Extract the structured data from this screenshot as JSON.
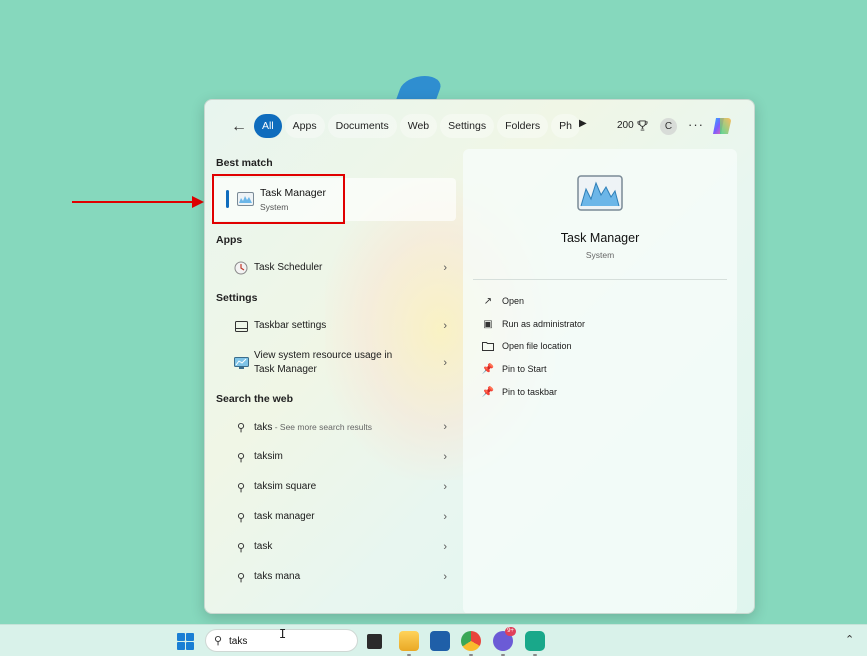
{
  "filters": {
    "items": [
      "All",
      "Apps",
      "Documents",
      "Web",
      "Settings",
      "Folders",
      "Ph"
    ],
    "active_index": 0,
    "points": "200"
  },
  "avatar_initial": "C",
  "sections": {
    "best_match": "Best match",
    "apps": "Apps",
    "settings": "Settings",
    "search_web": "Search the web"
  },
  "best_match": {
    "title": "Task Manager",
    "subtitle": "System"
  },
  "apps": [
    {
      "label": "Task Scheduler"
    }
  ],
  "settings": [
    {
      "label": "Taskbar settings"
    },
    {
      "label_line1": "View system resource usage in",
      "label_line2": "Task Manager"
    }
  ],
  "web": [
    {
      "label": "taks",
      "suffix": " - See more search results"
    },
    {
      "label": "taksim"
    },
    {
      "label": "taksim square"
    },
    {
      "label": "task manager"
    },
    {
      "label": "task"
    },
    {
      "label": "taks mana"
    }
  ],
  "preview": {
    "title": "Task Manager",
    "subtitle": "System",
    "actions": [
      "Open",
      "Run as administrator",
      "Open file location",
      "Pin to Start",
      "Pin to taskbar"
    ]
  },
  "taskbar": {
    "search_value": "taks",
    "notification_badge": "9+"
  },
  "colors": {
    "accent": "#0f6cbd",
    "highlight": "#e00000",
    "desktop": "#86d8bd"
  }
}
